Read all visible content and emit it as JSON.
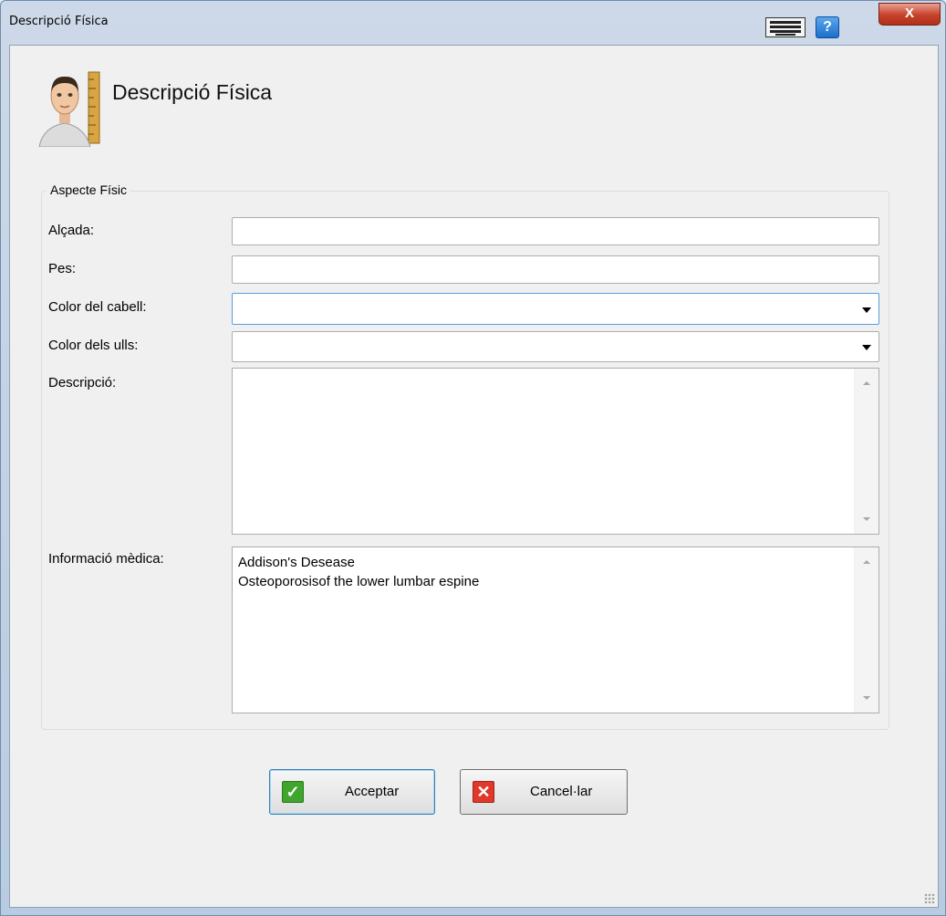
{
  "window": {
    "title": "Descripció Física",
    "icons": [
      "keyboard-icon",
      "help-icon",
      "close-icon"
    ],
    "help_glyph": "?",
    "close_glyph": "X"
  },
  "header": {
    "title": "Descripció Física",
    "icon": "person-with-ruler-icon"
  },
  "group": {
    "legend": "Aspecte Físic",
    "fields": {
      "height": {
        "label": "Alçada:",
        "value": ""
      },
      "weight": {
        "label": "Pes:",
        "value": ""
      },
      "hair_color": {
        "label": "Color del cabell:",
        "value": ""
      },
      "eye_color": {
        "label": "Color dels ulls:",
        "value": ""
      },
      "description": {
        "label": "Descripció:",
        "value": ""
      },
      "medical_info": {
        "label": "Informació mèdica:",
        "value": "Addison's Desease\nOsteoporosisof the lower lumbar espine"
      }
    }
  },
  "buttons": {
    "accept": {
      "label": "Acceptar",
      "icon": "checkmark-icon",
      "color": "#3fa52d",
      "glyph": "✓"
    },
    "cancel": {
      "label": "Cancel·lar",
      "icon": "x-icon",
      "color": "#e0392b",
      "glyph": "✕"
    }
  }
}
